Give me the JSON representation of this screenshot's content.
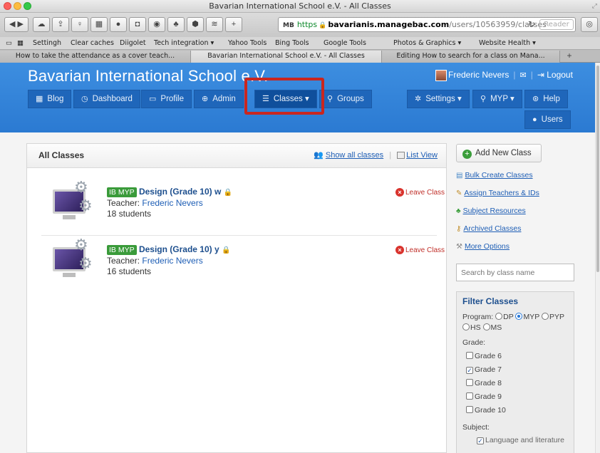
{
  "window": {
    "title": "Bavarian International School e.V. - All Classes"
  },
  "toolbar": {
    "url_mb": "MB",
    "url_scheme": "https",
    "url_host": "bavarianis.managebac.com",
    "url_path": "/users/10563959/classes",
    "reader_label": "Reader"
  },
  "bookmarks": [
    "Settingh",
    "Clear caches",
    "Diigolet",
    "Tech integration ▾",
    "Yahoo Tools",
    "Bing Tools",
    "Google Tools",
    "Photos & Graphics ▾",
    "Website Health ▾"
  ],
  "tabs": [
    "How to take the attendance as a cover teach...",
    "Bavarian International School e.V. - All Classes",
    "Editing How to search for a class on Mana..."
  ],
  "header": {
    "school_name": "Bavarian International School e.V.",
    "user_name": "Frederic Nevers",
    "logout_label": "Logout"
  },
  "nav": {
    "blog": "Blog",
    "dashboard": "Dashboard",
    "profile": "Profile",
    "admin": "Admin",
    "classes": "Classes",
    "groups": "Groups",
    "settings": "Settings",
    "myp": "MYP",
    "help": "Help",
    "users": "Users"
  },
  "panel": {
    "title": "All Classes",
    "show_all": "Show all classes",
    "list_view": "List View"
  },
  "classes": [
    {
      "badge": "IB MYP",
      "name": "Design (Grade 10) w",
      "teacher_label": "Teacher:",
      "teacher": "Frederic Nevers",
      "students": "18 students",
      "leave": "Leave Class"
    },
    {
      "badge": "IB MYP",
      "name": "Design (Grade 10) y",
      "teacher_label": "Teacher:",
      "teacher": "Frederic Nevers",
      "students": "16 students",
      "leave": "Leave Class"
    }
  ],
  "sidebar": {
    "add_new": "Add New Class",
    "links": [
      "Bulk Create Classes",
      "Assign Teachers & IDs",
      "Subject Resources",
      "Archived Classes",
      "More Options"
    ],
    "search_placeholder": "Search by class name",
    "filter": {
      "title": "Filter Classes",
      "program_label": "Program:",
      "programs": [
        "DP",
        "MYP",
        "PYP",
        "HS",
        "MS"
      ],
      "selected_program": "MYP",
      "grade_label": "Grade:",
      "grades": [
        "Grade 6",
        "Grade 7",
        "Grade 8",
        "Grade 9",
        "Grade 10"
      ],
      "checked_grade": "Grade 7",
      "subject_label": "Subject:",
      "subject_first": "Language and literature"
    }
  },
  "colors": {
    "header_blue": "#2f82d8",
    "highlight_red": "#c9261f",
    "ib_badge_green": "#3a9b3a"
  }
}
